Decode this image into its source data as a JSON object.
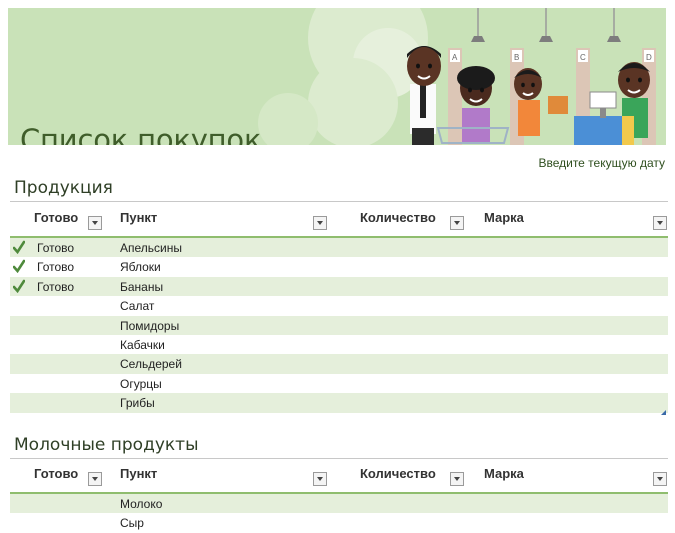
{
  "banner": {
    "title": "Список покупок"
  },
  "date_prompt": "Введите текущую дату",
  "columns": {
    "ready": "Готово",
    "item": "Пункт",
    "quantity": "Количество",
    "brand": "Марка"
  },
  "sections": [
    {
      "title": "Продукция",
      "rows": [
        {
          "ready": "Готово",
          "item": "Апельсины",
          "checked": true
        },
        {
          "ready": "Готово",
          "item": "Яблоки",
          "checked": true
        },
        {
          "ready": "Готово",
          "item": "Бананы",
          "checked": true
        },
        {
          "ready": "",
          "item": "Салат",
          "checked": false
        },
        {
          "ready": "",
          "item": "Помидоры",
          "checked": false
        },
        {
          "ready": "",
          "item": "Кабачки",
          "checked": false
        },
        {
          "ready": "",
          "item": "Сельдерей",
          "checked": false
        },
        {
          "ready": "",
          "item": "Огурцы",
          "checked": false
        },
        {
          "ready": "",
          "item": "Грибы",
          "checked": false
        }
      ]
    },
    {
      "title": "Молочные продукты",
      "rows": [
        {
          "ready": "",
          "item": "Молоко",
          "checked": false
        },
        {
          "ready": "",
          "item": "Сыр",
          "checked": false
        }
      ]
    }
  ],
  "colors": {
    "accent": "#8fbd6e",
    "band": "#e5efdb",
    "title": "#3f5d2a",
    "check": "#4f8a3c"
  }
}
